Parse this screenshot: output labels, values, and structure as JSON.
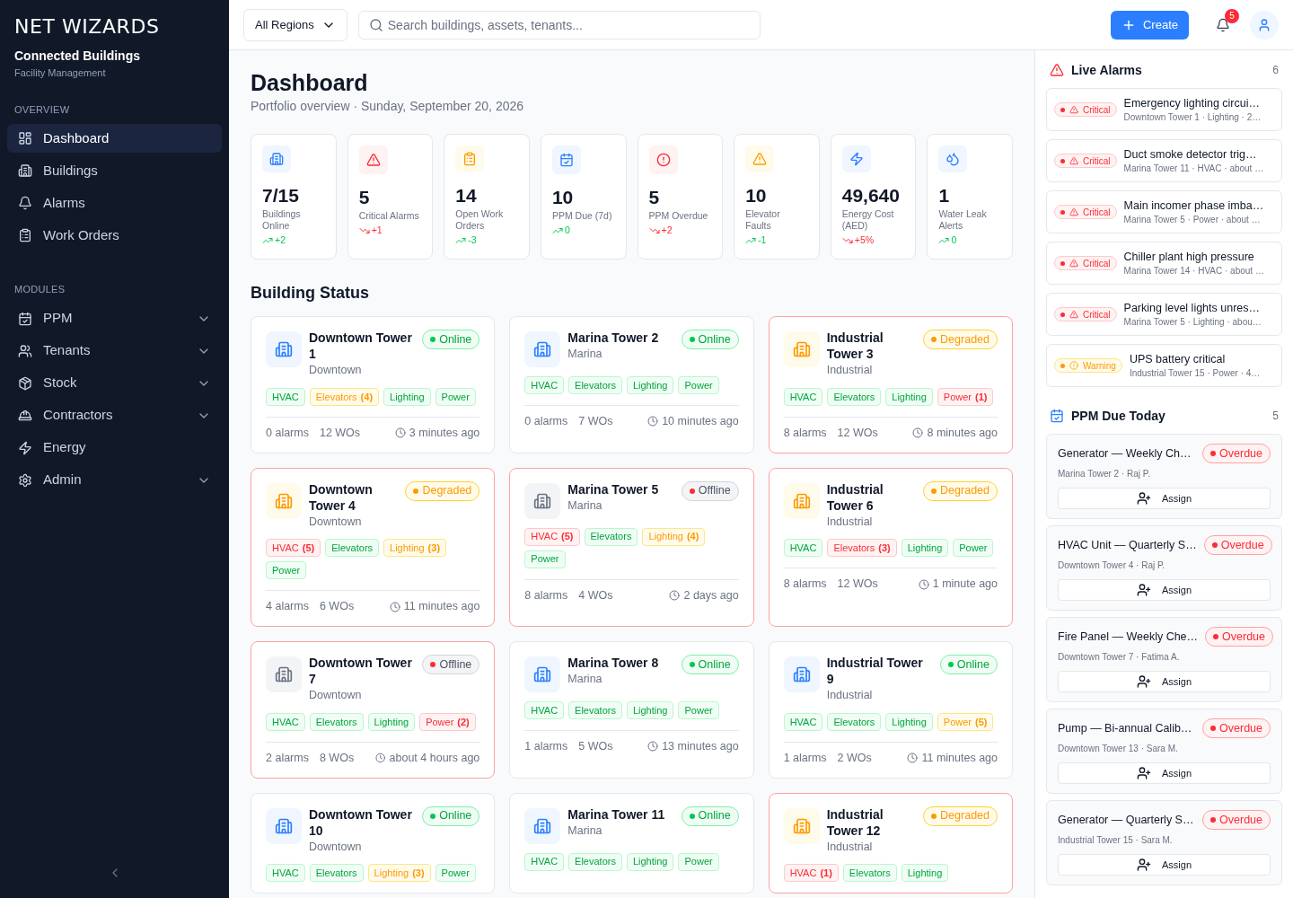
{
  "sidebar": {
    "logo": "NET WIZARDS",
    "app_name": "Connected Buildings",
    "app_subtitle": "Facility Management",
    "sections": [
      {
        "heading": "OVERVIEW",
        "items": [
          {
            "label": "Dashboard",
            "selected": true,
            "expandable": false
          },
          {
            "label": "Buildings",
            "selected": false,
            "expandable": false
          },
          {
            "label": "Alarms",
            "selected": false,
            "expandable": false
          },
          {
            "label": "Work Orders",
            "selected": false,
            "expandable": false
          }
        ]
      },
      {
        "heading": "MODULES",
        "items": [
          {
            "label": "PPM",
            "selected": false,
            "expandable": true
          },
          {
            "label": "Tenants",
            "selected": false,
            "expandable": true
          },
          {
            "label": "Stock",
            "selected": false,
            "expandable": true
          },
          {
            "label": "Contractors",
            "selected": false,
            "expandable": true
          },
          {
            "label": "Energy",
            "selected": false,
            "expandable": false
          },
          {
            "label": "Admin",
            "selected": false,
            "expandable": true
          }
        ]
      }
    ]
  },
  "header": {
    "region": "All Regions",
    "search": {
      "placeholder": "Search buildings, assets, tenants..."
    },
    "create_label": "Create",
    "notification_count": "5"
  },
  "page": {
    "title": "Dashboard",
    "subtitle": "Portfolio overview · Sunday, September 20, 2026"
  },
  "kpis": [
    {
      "value": "7/15",
      "label": "Buildings Online",
      "delta": "+2",
      "trend_up": true
    },
    {
      "value": "5",
      "label": "Critical Alarms",
      "delta": "+1",
      "trend_up": false
    },
    {
      "value": "14",
      "label": "Open Work Orders",
      "delta": "-3",
      "trend_up": true
    },
    {
      "value": "10",
      "label": "PPM Due (7d)",
      "delta": "0",
      "trend_up": true
    },
    {
      "value": "5",
      "label": "PPM Overdue",
      "delta": "+2",
      "trend_up": false
    },
    {
      "value": "10",
      "label": "Elevator Faults",
      "delta": "-1",
      "trend_up": true
    },
    {
      "value": "49,640",
      "label": "Energy Cost (AED)",
      "delta": "+5%",
      "trend_up": false
    },
    {
      "value": "1",
      "label": "Water Leak Alerts",
      "delta": "0",
      "trend_up": true
    }
  ],
  "building_status": {
    "title": "Building Status",
    "buildings": [
      {
        "name": "Downtown Tower 1",
        "area": "Downtown",
        "kind": "online",
        "status_label": "Online",
        "systems": [
          {
            "label": "HVAC",
            "kind": "ok"
          },
          {
            "label": "Elevators",
            "count": "(4)",
            "kind": "warning"
          },
          {
            "label": "Lighting",
            "kind": "ok"
          },
          {
            "label": "Power",
            "kind": "ok"
          }
        ],
        "alarms": "0 alarms",
        "work_orders": "12 WOs",
        "updated": "3 minutes ago"
      },
      {
        "name": "Marina Tower 2",
        "area": "Marina",
        "kind": "online",
        "status_label": "Online",
        "systems": [
          {
            "label": "HVAC",
            "kind": "ok"
          },
          {
            "label": "Elevators",
            "kind": "ok"
          },
          {
            "label": "Lighting",
            "kind": "ok"
          },
          {
            "label": "Power",
            "kind": "ok"
          }
        ],
        "alarms": "0 alarms",
        "work_orders": "7 WOs",
        "updated": "10 minutes ago"
      },
      {
        "name": "Industrial Tower 3",
        "area": "Industrial",
        "kind": "degraded",
        "status_label": "Degraded",
        "systems": [
          {
            "label": "HVAC",
            "kind": "ok"
          },
          {
            "label": "Elevators",
            "kind": "ok"
          },
          {
            "label": "Lighting",
            "kind": "ok"
          },
          {
            "label": "Power",
            "count": "(1)",
            "kind": "critical"
          }
        ],
        "alarms": "8 alarms",
        "work_orders": "12 WOs",
        "updated": "8 minutes ago"
      },
      {
        "name": "Downtown Tower 4",
        "area": "Downtown",
        "kind": "degraded",
        "status_label": "Degraded",
        "systems": [
          {
            "label": "HVAC",
            "count": "(5)",
            "kind": "critical"
          },
          {
            "label": "Elevators",
            "kind": "ok"
          },
          {
            "label": "Lighting",
            "count": "(3)",
            "kind": "warning"
          },
          {
            "label": "Power",
            "kind": "ok"
          }
        ],
        "alarms": "4 alarms",
        "work_orders": "6 WOs",
        "updated": "11 minutes ago"
      },
      {
        "name": "Marina Tower 5",
        "area": "Marina",
        "kind": "offline",
        "status_label": "Offline",
        "systems": [
          {
            "label": "HVAC",
            "count": "(5)",
            "kind": "critical"
          },
          {
            "label": "Elevators",
            "kind": "ok"
          },
          {
            "label": "Lighting",
            "count": "(4)",
            "kind": "warning"
          },
          {
            "label": "Power",
            "kind": "ok"
          }
        ],
        "alarms": "8 alarms",
        "work_orders": "4 WOs",
        "updated": "2 days ago"
      },
      {
        "name": "Industrial Tower 6",
        "area": "Industrial",
        "kind": "degraded",
        "status_label": "Degraded",
        "systems": [
          {
            "label": "HVAC",
            "kind": "ok"
          },
          {
            "label": "Elevators",
            "count": "(3)",
            "kind": "critical"
          },
          {
            "label": "Lighting",
            "kind": "ok"
          },
          {
            "label": "Power",
            "kind": "ok"
          }
        ],
        "alarms": "8 alarms",
        "work_orders": "12 WOs",
        "updated": "1 minute ago"
      },
      {
        "name": "Downtown Tower 7",
        "area": "Downtown",
        "kind": "offline",
        "status_label": "Offline",
        "systems": [
          {
            "label": "HVAC",
            "kind": "ok"
          },
          {
            "label": "Elevators",
            "kind": "ok"
          },
          {
            "label": "Lighting",
            "kind": "ok"
          },
          {
            "label": "Power",
            "count": "(2)",
            "kind": "critical"
          }
        ],
        "alarms": "2 alarms",
        "work_orders": "8 WOs",
        "updated": "about 4 hours ago"
      },
      {
        "name": "Marina Tower 8",
        "area": "Marina",
        "kind": "online",
        "status_label": "Online",
        "systems": [
          {
            "label": "HVAC",
            "kind": "ok"
          },
          {
            "label": "Elevators",
            "kind": "ok"
          },
          {
            "label": "Lighting",
            "kind": "ok"
          },
          {
            "label": "Power",
            "kind": "ok"
          }
        ],
        "alarms": "1 alarms",
        "work_orders": "5 WOs",
        "updated": "13 minutes ago"
      },
      {
        "name": "Industrial Tower 9",
        "area": "Industrial",
        "kind": "online",
        "status_label": "Online",
        "systems": [
          {
            "label": "HVAC",
            "kind": "ok"
          },
          {
            "label": "Elevators",
            "kind": "ok"
          },
          {
            "label": "Lighting",
            "kind": "ok"
          },
          {
            "label": "Power",
            "count": "(5)",
            "kind": "warning"
          }
        ],
        "alarms": "1 alarms",
        "work_orders": "2 WOs",
        "updated": "11 minutes ago"
      },
      {
        "name": "Downtown Tower 10",
        "area": "Downtown",
        "kind": "online",
        "status_label": "Online",
        "systems": [
          {
            "label": "HVAC",
            "kind": "ok"
          },
          {
            "label": "Elevators",
            "kind": "ok"
          },
          {
            "label": "Lighting",
            "count": "(3)",
            "kind": "warning"
          },
          {
            "label": "Power",
            "kind": "ok"
          }
        ]
      },
      {
        "name": "Marina Tower 11",
        "area": "Marina",
        "kind": "online",
        "status_label": "Online",
        "systems": [
          {
            "label": "HVAC",
            "kind": "ok"
          },
          {
            "label": "Elevators",
            "kind": "ok"
          },
          {
            "label": "Lighting",
            "kind": "ok"
          },
          {
            "label": "Power",
            "kind": "ok"
          }
        ]
      },
      {
        "name": "Industrial Tower 12",
        "area": "Industrial",
        "kind": "degraded",
        "status_label": "Degraded",
        "systems": [
          {
            "label": "HVAC",
            "count": "(1)",
            "kind": "critical"
          },
          {
            "label": "Elevators",
            "kind": "ok"
          },
          {
            "label": "Lighting",
            "kind": "ok"
          }
        ]
      }
    ]
  },
  "live_alarms": {
    "title": "Live Alarms",
    "count": "6",
    "alarms": [
      {
        "kind": "critical",
        "severity_label": "Critical",
        "title": "Emergency lighting circui…",
        "meta": "Downtown Tower 1 · Lighting · 2…"
      },
      {
        "kind": "critical",
        "severity_label": "Critical",
        "title": "Duct smoke detector trig…",
        "meta": "Marina Tower 11 · HVAC · about …"
      },
      {
        "kind": "critical",
        "severity_label": "Critical",
        "title": "Main incomer phase imba…",
        "meta": "Marina Tower 5 · Power · about …"
      },
      {
        "kind": "critical",
        "severity_label": "Critical",
        "title": "Chiller plant high pressure",
        "meta": "Marina Tower 14 · HVAC · about …"
      },
      {
        "kind": "critical",
        "severity_label": "Critical",
        "title": "Parking level lights unres…",
        "meta": "Marina Tower 5 · Lighting · abou…"
      },
      {
        "kind": "warning",
        "severity_label": "Warning",
        "title": "UPS battery critical",
        "meta": "Industrial Tower 15 · Power · 4…"
      }
    ]
  },
  "ppm_due": {
    "title": "PPM Due Today",
    "count": "5",
    "tasks": [
      {
        "title": "Generator — Weekly Ch…",
        "status_label": "Overdue",
        "meta": "Marina Tower 2 · Raj P.",
        "assign_label": "Assign"
      },
      {
        "title": "HVAC Unit — Quarterly S…",
        "status_label": "Overdue",
        "meta": "Downtown Tower 4 · Raj P.",
        "assign_label": "Assign"
      },
      {
        "title": "Fire Panel — Weekly Che…",
        "status_label": "Overdue",
        "meta": "Downtown Tower 7 · Fatima A.",
        "assign_label": "Assign"
      },
      {
        "title": "Pump — Bi-annual Calib…",
        "status_label": "Overdue",
        "meta": "Downtown Tower 13 · Sara M.",
        "assign_label": "Assign"
      },
      {
        "title": "Generator — Quarterly S…",
        "status_label": "Overdue",
        "meta": "Industrial Tower 15 · Sara M.",
        "assign_label": "Assign"
      }
    ]
  }
}
